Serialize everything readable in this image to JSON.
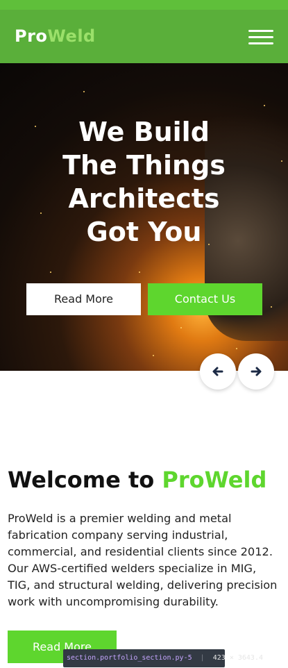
{
  "brand": {
    "part1": "Pro",
    "part2": "Weld"
  },
  "nav": {
    "menu_icon": "hamburger-icon"
  },
  "hero": {
    "lines": [
      "We Build",
      "The Things",
      "Architects",
      "Got You"
    ],
    "read_more": "Read More",
    "contact": "Contact Us"
  },
  "slider": {
    "prev_icon": "arrow-left-icon",
    "next_icon": "arrow-right-icon"
  },
  "welcome": {
    "title_prefix": "Welcome to",
    "title_brand": "ProWeld",
    "body": "ProWeld is a premier welding and metal fabrication company serving industrial, commercial, and residential clients since 2012. Our AWS-certified welders specialize in MIG, TIG, and structural welding, delivering precision work with uncompromising durability.",
    "read_more": "Read More"
  },
  "devtools_tooltip": {
    "selector": "section.portfolio_section.py-5",
    "size": "423 × 3643.4"
  },
  "colors": {
    "nav_green": "#5aaf3a",
    "accent_green": "#5ed62e",
    "brand_light": "#9be06a"
  }
}
